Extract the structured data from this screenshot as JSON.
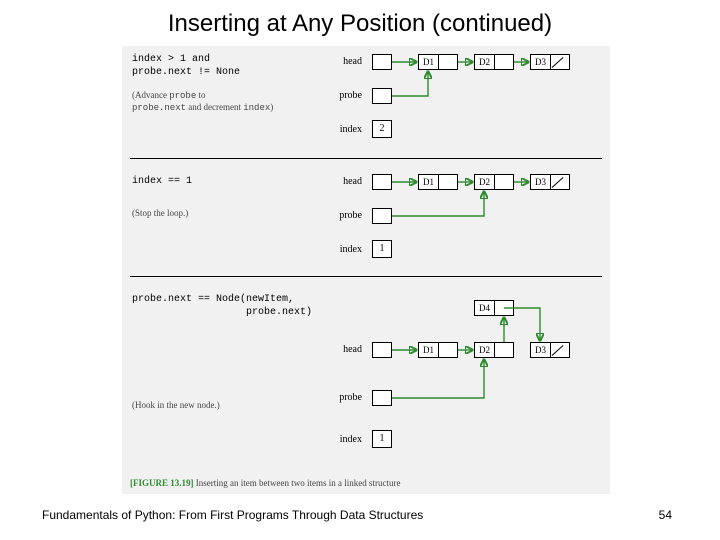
{
  "title": "Inserting at Any Position (continued)",
  "footer_left": "Fundamentals of Python: From First Programs Through Data Structures",
  "page_number": "54",
  "figure_tag": "[FIGURE 13.19]",
  "figure_caption": "Inserting an item between two items in a linked structure",
  "labels": {
    "head": "head",
    "probe": "probe",
    "index": "index"
  },
  "nodes": {
    "d1": "D1",
    "d2": "D2",
    "d3": "D3",
    "d4": "D4"
  },
  "stage1": {
    "code1": "index > 1 and",
    "code2": "probe.next != None",
    "note1a": "(Advance ",
    "note1b": "probe",
    "note1c": " to",
    "note2a": "probe.next",
    "note2b": " and decrement ",
    "note2c": "index",
    "note2d": ")",
    "index_value": "2"
  },
  "stage2": {
    "code": "index == 1",
    "note": "(Stop the loop.)",
    "index_value": "1"
  },
  "stage3": {
    "code1": "probe.next == Node(newItem,",
    "code2": "                   probe.next)",
    "note": "(Hook in the new node.)",
    "index_value": "1"
  }
}
